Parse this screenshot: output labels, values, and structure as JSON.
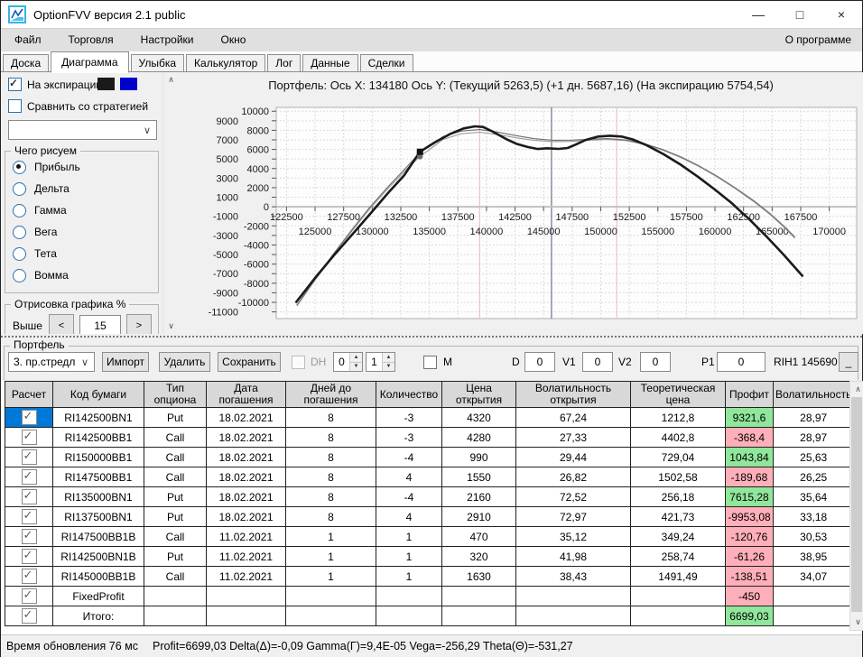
{
  "window": {
    "title": "OptionFVV версия 2.1 public",
    "controls": {
      "minimize": "—",
      "maximize": "□",
      "close": "×"
    }
  },
  "menu": {
    "items": [
      "Файл",
      "Торговля",
      "Настройки",
      "Окно"
    ],
    "slugs": [
      "file",
      "trading",
      "settings",
      "window"
    ],
    "right": "О программе"
  },
  "tabs": {
    "items": [
      "Доска",
      "Диаграмма",
      "Улыбка",
      "Калькулятор",
      "Лог",
      "Данные",
      "Сделки"
    ],
    "slugs": [
      "board",
      "diagram",
      "smile",
      "calculator",
      "log",
      "data",
      "deals"
    ],
    "active": "Диаграмма"
  },
  "sidebar": {
    "expiration_checkbox": {
      "label": "На экспирацию",
      "checked": true
    },
    "swatch_colors": [
      "#1a1a1a",
      "#0000cc"
    ],
    "compare_checkbox": {
      "label": "Сравнить со стратегией",
      "checked": false
    },
    "strategy_select": {
      "value": ""
    },
    "plot_what_group": {
      "title": "Чего рисуем",
      "options": [
        "Прибыль",
        "Дельта",
        "Гамма",
        "Вега",
        "Тета",
        "Вомма"
      ],
      "slugs": [
        "profit",
        "delta",
        "gamma",
        "vega",
        "theta",
        "vomma"
      ],
      "selected": "Прибыль"
    },
    "render_group": {
      "title": "Отрисовка графика %",
      "rows": [
        {
          "label": "Выше",
          "value": "15"
        }
      ],
      "dec_label": "<",
      "inc_label": ">"
    }
  },
  "chart_data": {
    "type": "line",
    "title": "Портфель: Ось X: 134180 Ось Y:  (Текущий 5263,5)  (+1 дн. 5687,16)  (На экспирацию 5754,54)",
    "xlabel": "",
    "ylabel": "",
    "x_range": [
      121600,
      172400
    ],
    "y_range": [
      -11700,
      10400
    ],
    "grid": {
      "on": true,
      "x_start": 122500,
      "x_end": 170000,
      "x_step": 2500,
      "y_start": -11000,
      "y_end": 10000,
      "y_step": 1000
    },
    "x_ticks_upper": [
      122500,
      127500,
      132500,
      137500,
      142500,
      147500,
      152500,
      157500,
      162500,
      167500
    ],
    "x_ticks_lower": [
      125000,
      130000,
      135000,
      140000,
      145000,
      150000,
      155000,
      160000,
      165000,
      170000
    ],
    "y_ticks_inner": [
      10000,
      8000,
      6000,
      4000,
      2000,
      0,
      -2000,
      -4000,
      -6000,
      -8000,
      -10000
    ],
    "y_ticks_outer": [
      9000,
      7000,
      5000,
      3000,
      1000,
      -1000,
      -3000,
      -5000,
      -7000,
      -9000,
      -11000
    ],
    "vlines": [
      {
        "x": 139400,
        "color": "#f0b4bd",
        "width": 1
      },
      {
        "x": 145690,
        "color": "#6f8090",
        "width": 1.3
      },
      {
        "x": 151400,
        "color": "#f0b4bd",
        "width": 1
      }
    ],
    "marker": {
      "x": 134180,
      "current_y": 5263.5,
      "plus1_y": 5687.16,
      "expiration_y": 5754.54
    },
    "series": [
      {
        "name": "На экспирацию",
        "color": "#1a1a1a",
        "width": 2.6,
        "points": [
          [
            123300,
            -10050
          ],
          [
            125000,
            -7450
          ],
          [
            126700,
            -5000
          ],
          [
            128400,
            -2700
          ],
          [
            130000,
            -500
          ],
          [
            130350,
            0
          ],
          [
            131500,
            1600
          ],
          [
            132800,
            3300
          ],
          [
            134180,
            5755
          ],
          [
            135500,
            6750
          ],
          [
            136800,
            7600
          ],
          [
            138000,
            8200
          ],
          [
            139000,
            8420
          ],
          [
            139700,
            8350
          ],
          [
            140500,
            7900
          ],
          [
            141700,
            7100
          ],
          [
            142600,
            6600
          ],
          [
            143600,
            6250
          ],
          [
            144500,
            6050
          ],
          [
            145300,
            6120
          ],
          [
            146300,
            6060
          ],
          [
            147100,
            6150
          ],
          [
            147700,
            6450
          ],
          [
            148700,
            7000
          ],
          [
            149800,
            7350
          ],
          [
            150800,
            7430
          ],
          [
            151800,
            7350
          ],
          [
            152800,
            7050
          ],
          [
            154000,
            6450
          ],
          [
            155500,
            5500
          ],
          [
            157000,
            4400
          ],
          [
            158500,
            3150
          ],
          [
            160000,
            1800
          ],
          [
            161500,
            350
          ],
          [
            161800,
            0
          ],
          [
            163000,
            -1300
          ],
          [
            164500,
            -3100
          ],
          [
            166000,
            -5000
          ],
          [
            167700,
            -7300
          ]
        ]
      },
      {
        "name": "+1 дн.",
        "color": "#6e6e6e",
        "width": 1.1,
        "points": [
          [
            123400,
            -10300
          ],
          [
            125000,
            -7560
          ],
          [
            126600,
            -4940
          ],
          [
            128200,
            -2440
          ],
          [
            129800,
            -40
          ],
          [
            131400,
            2120
          ],
          [
            133000,
            4130
          ],
          [
            134180,
            5687
          ],
          [
            136200,
            7350
          ],
          [
            137800,
            7930
          ],
          [
            139400,
            8080
          ],
          [
            141000,
            7810
          ],
          [
            142600,
            7440
          ],
          [
            144200,
            7120
          ],
          [
            145800,
            6960
          ],
          [
            147400,
            6970
          ],
          [
            149000,
            7070
          ],
          [
            150600,
            7130
          ],
          [
            152200,
            7000
          ],
          [
            153800,
            6610
          ],
          [
            155400,
            6010
          ],
          [
            157000,
            5230
          ],
          [
            158600,
            4290
          ],
          [
            160200,
            3190
          ],
          [
            161800,
            1970
          ],
          [
            163400,
            630
          ],
          [
            164800,
            -690
          ],
          [
            166000,
            -1980
          ],
          [
            167000,
            -3170
          ]
        ]
      },
      {
        "name": "Текущий",
        "color": "#9a9a9a",
        "width": 1.1,
        "points": [
          [
            123400,
            -10400
          ],
          [
            125000,
            -7680
          ],
          [
            126600,
            -5070
          ],
          [
            128200,
            -2580
          ],
          [
            129800,
            -190
          ],
          [
            131400,
            1940
          ],
          [
            133000,
            3920
          ],
          [
            134180,
            5263
          ],
          [
            136200,
            7050
          ],
          [
            137800,
            7640
          ],
          [
            139400,
            7800
          ],
          [
            141000,
            7550
          ],
          [
            142600,
            7220
          ],
          [
            144200,
            6940
          ],
          [
            145800,
            6820
          ],
          [
            147400,
            6840
          ],
          [
            149000,
            6960
          ],
          [
            150600,
            7040
          ],
          [
            152200,
            6920
          ],
          [
            153800,
            6540
          ],
          [
            155400,
            5940
          ],
          [
            157000,
            5160
          ],
          [
            158600,
            4210
          ],
          [
            160200,
            3110
          ],
          [
            161800,
            1880
          ],
          [
            163400,
            530
          ],
          [
            164800,
            -800
          ],
          [
            166000,
            -2100
          ],
          [
            167000,
            -3300
          ]
        ]
      }
    ]
  },
  "portfolio": {
    "group_title": "Портфель",
    "select_value": "3. пр.стредл",
    "import_label": "Импорт",
    "delete_label": "Удалить",
    "save_label": "Сохранить",
    "dh_label": "DH",
    "dh_spin1": "0",
    "dh_spin2": "1",
    "m_label": "M",
    "d_label": "D",
    "d_value": "0",
    "v1_label": "V1",
    "v1_value": "0",
    "v2_label": "V2",
    "v2_value": "0",
    "p1_label": "P1",
    "p1_value": "0",
    "instrument_text": "RIH1 145690",
    "underscore_label": "_"
  },
  "table": {
    "columns": [
      "Расчет",
      "Код бумаги",
      "Тип\nопциона",
      "Дата\nпогашения",
      "Дней до\nпогашения",
      "Количество",
      "Цена\nоткрытия",
      "Волатильность\nоткрытия",
      "Теоретическая\nцена",
      "Профит",
      "Волатильность"
    ],
    "rows": [
      {
        "checked": true,
        "selected": true,
        "cells": [
          "RI142500BN1",
          "Put",
          "18.02.2021",
          "8",
          "-3",
          "4320",
          "67,24",
          "1212,8",
          "9321,6",
          "28,97"
        ],
        "profit_color": "green"
      },
      {
        "checked": true,
        "selected": false,
        "cells": [
          "RI142500BB1",
          "Call",
          "18.02.2021",
          "8",
          "-3",
          "4280",
          "27,33",
          "4402,8",
          "-368,4",
          "28,97"
        ],
        "profit_color": "red"
      },
      {
        "checked": true,
        "selected": false,
        "cells": [
          "RI150000BB1",
          "Call",
          "18.02.2021",
          "8",
          "-4",
          "990",
          "29,44",
          "729,04",
          "1043,84",
          "25,63"
        ],
        "profit_color": "green"
      },
      {
        "checked": true,
        "selected": false,
        "cells": [
          "RI147500BB1",
          "Call",
          "18.02.2021",
          "8",
          "4",
          "1550",
          "26,82",
          "1502,58",
          "-189,68",
          "26,25"
        ],
        "profit_color": "red"
      },
      {
        "checked": true,
        "selected": false,
        "cells": [
          "RI135000BN1",
          "Put",
          "18.02.2021",
          "8",
          "-4",
          "2160",
          "72,52",
          "256,18",
          "7615,28",
          "35,64"
        ],
        "profit_color": "green"
      },
      {
        "checked": true,
        "selected": false,
        "cells": [
          "RI137500BN1",
          "Put",
          "18.02.2021",
          "8",
          "4",
          "2910",
          "72,97",
          "421,73",
          "-9953,08",
          "33,18"
        ],
        "profit_color": "red"
      },
      {
        "checked": true,
        "selected": false,
        "cells": [
          "RI147500BB1B",
          "Call",
          "11.02.2021",
          "1",
          "1",
          "470",
          "35,12",
          "349,24",
          "-120,76",
          "30,53"
        ],
        "profit_color": "red"
      },
      {
        "checked": true,
        "selected": false,
        "cells": [
          "RI142500BN1B",
          "Put",
          "11.02.2021",
          "1",
          "1",
          "320",
          "41,98",
          "258,74",
          "-61,26",
          "38,95"
        ],
        "profit_color": "red"
      },
      {
        "checked": true,
        "selected": false,
        "cells": [
          "RI145000BB1B",
          "Call",
          "11.02.2021",
          "1",
          "1",
          "1630",
          "38,43",
          "1491,49",
          "-138,51",
          "34,07"
        ],
        "profit_color": "red"
      },
      {
        "checked": true,
        "selected": false,
        "cells": [
          "FixedProfit",
          "",
          "",
          "",
          "",
          "",
          "",
          "",
          "-450",
          ""
        ],
        "profit_color": "red"
      },
      {
        "checked": true,
        "selected": false,
        "cells": [
          "Итого:",
          "",
          "",
          "",
          "",
          "",
          "",
          "",
          "6699,03",
          ""
        ],
        "profit_color": "green"
      }
    ]
  },
  "status_bar": {
    "update_time": "Время обновления 76 мс",
    "greeks": "Profit=6699,03 Delta(Δ)=-0,09 Gamma(Γ)=9,4E-05 Vega=-256,29 Theta(Θ)=-531,27"
  }
}
